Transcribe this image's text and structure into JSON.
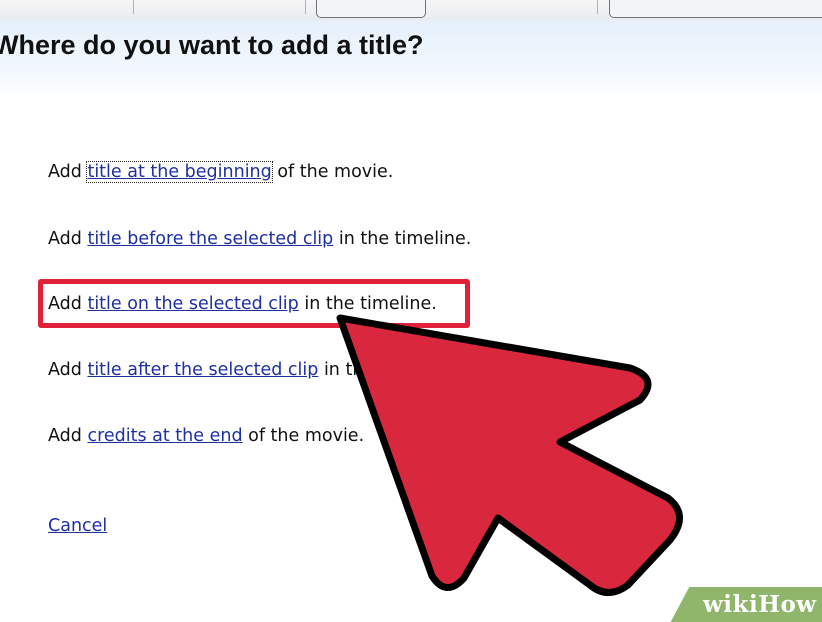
{
  "dialog": {
    "title": "Where do you want to add a title?"
  },
  "options": [
    {
      "prefix": "Add ",
      "link": "title at the beginning",
      "suffix": " of the movie."
    },
    {
      "prefix": "Add ",
      "link": "title before the selected clip",
      "suffix": " in the timeline."
    },
    {
      "prefix": "Add ",
      "link": "title on the selected clip",
      "suffix": " in the timeline."
    },
    {
      "prefix": "Add ",
      "link": "title after the selected clip",
      "suffix": " in the timeline."
    },
    {
      "prefix": "Add ",
      "link": "credits at the end",
      "suffix": " of the movie."
    }
  ],
  "cancel_label": "Cancel",
  "highlighted_option_index": 2,
  "watermark": {
    "part1": "wiki",
    "part2": "How"
  },
  "colors": {
    "link": "#1d2fa3",
    "highlight_box": "#e1203a",
    "arrow_fill": "#d9283e",
    "badge": "#8fb66b"
  }
}
